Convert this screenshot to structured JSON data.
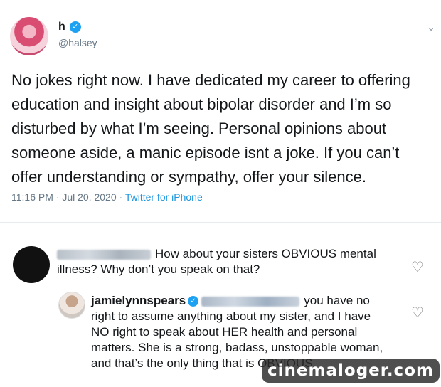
{
  "tweet": {
    "display_name": "h",
    "handle": "@halsey",
    "text": "No jokes right now. I have dedicated my career to offering education and insight about bipolar disorder and I’m so disturbed by what I’m seeing. Personal opinions about someone aside, a manic episode isnt a joke. If you can’t offer understanding or sympathy, offer your silence.",
    "timestamp": "11:16 PM · Jul 20, 2020 ·",
    "source": "Twitter for iPhone",
    "caret_icon": "chevron-down-icon"
  },
  "comments": [
    {
      "text": "How about your sisters OBVIOUS mental illness? Why don’t you speak on that?",
      "like_icon": "heart-icon"
    },
    {
      "username": "jamielynnspears",
      "text": "you have no right to assume anything about my sister, and I have NO right to speak about HER health and personal matters. She is a strong, badass, unstoppable woman, and that’s the only thing that is OBVIOUS.",
      "like_icon": "heart-icon"
    }
  ],
  "watermark": "cinemaloger.com"
}
